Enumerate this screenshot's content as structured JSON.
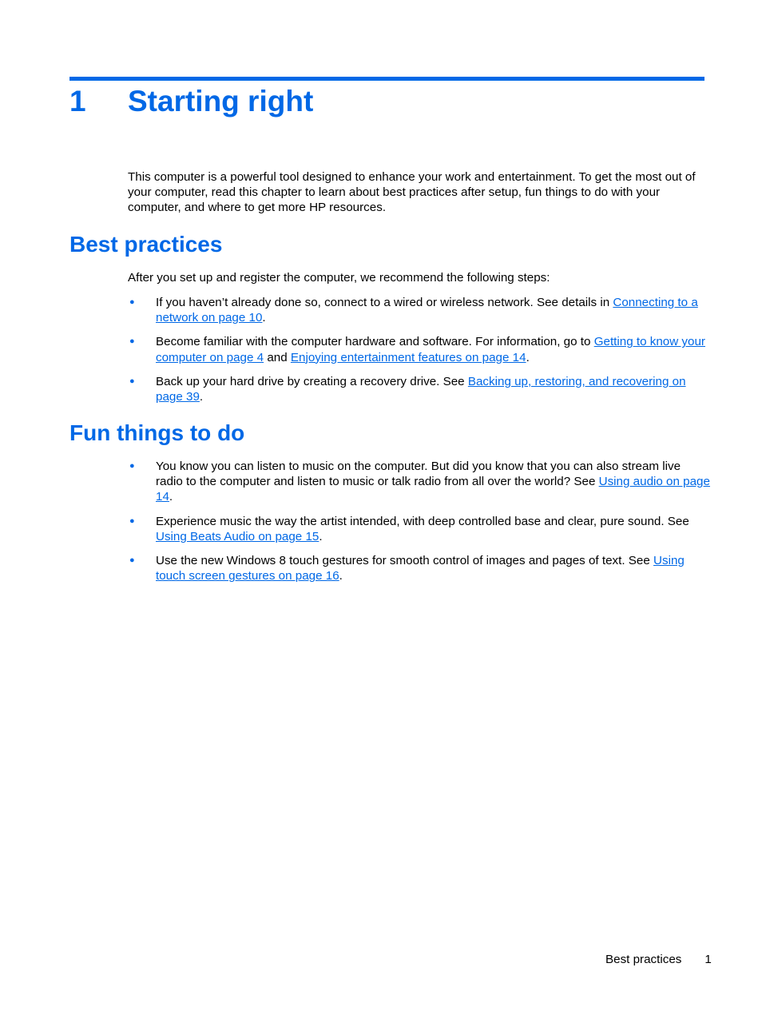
{
  "chapter": {
    "number": "1",
    "title": "Starting right"
  },
  "intro": "This computer is a powerful tool designed to enhance your work and entertainment. To get the most out of your computer, read this chapter to learn about best practices after setup, fun things to do with your computer, and where to get more HP resources.",
  "best_practices": {
    "heading": "Best practices",
    "lead": "After you set up and register the computer, we recommend the following steps:",
    "items": [
      {
        "text": "If you haven’t already done so, connect to a wired or wireless network. See details in ",
        "link": "Connecting to a network on page 10",
        "after": "."
      },
      {
        "text": "Become familiar with the computer hardware and software. For information, go to ",
        "link": "Getting to know your computer on page 4",
        "mid": " and ",
        "link2": "Enjoying entertainment features on page 14",
        "after": "."
      },
      {
        "text": "Back up your hard drive by creating a recovery drive. See ",
        "link": "Backing up, restoring, and recovering on page 39",
        "after": "."
      }
    ]
  },
  "fun_things": {
    "heading": "Fun things to do",
    "items": [
      {
        "text": "You know you can listen to music on the computer. But did you know that you can also stream live radio to the computer and listen to music or talk radio from all over the world? See ",
        "link": "Using audio on page 14",
        "after": "."
      },
      {
        "text": "Experience music the way the artist intended, with deep controlled base and clear, pure sound. See ",
        "link": "Using Beats Audio on page 15",
        "after": "."
      },
      {
        "text": "Use the new Windows 8 touch gestures for smooth control of images and pages of text. See ",
        "link": "Using touch screen gestures on page 16",
        "after": "."
      }
    ]
  },
  "footer": {
    "section": "Best practices",
    "page": "1"
  },
  "bullet_glyph": "●",
  "colors": {
    "accent": "#0068e6"
  }
}
